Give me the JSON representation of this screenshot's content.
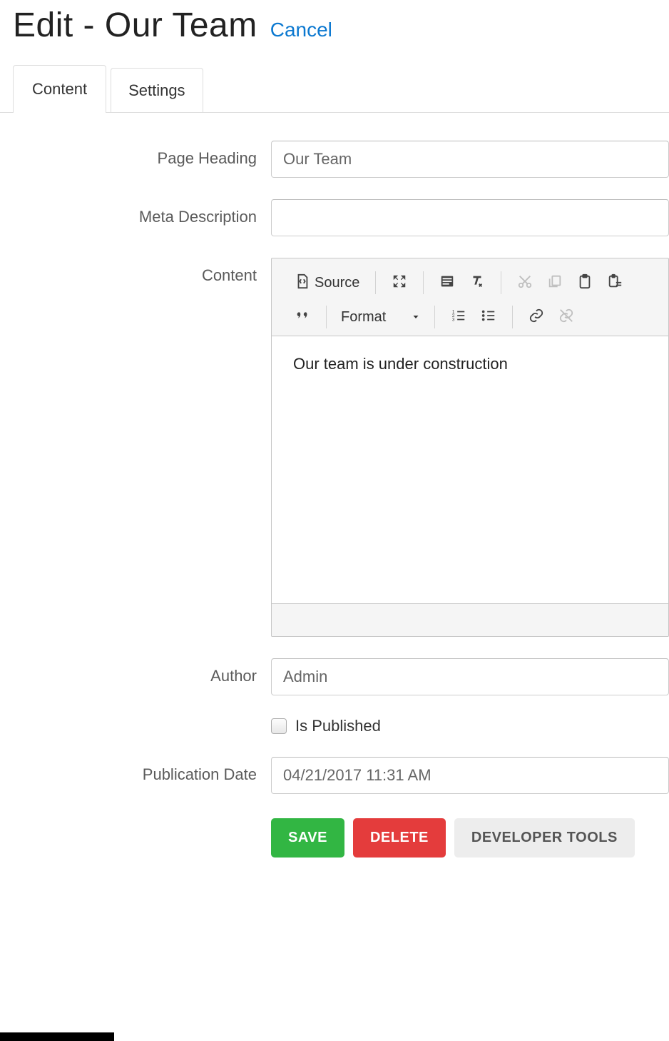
{
  "header": {
    "title": "Edit - Our Team",
    "cancel_label": "Cancel"
  },
  "tabs": {
    "content": "Content",
    "settings": "Settings"
  },
  "form": {
    "page_heading": {
      "label": "Page Heading",
      "value": "Our Team"
    },
    "meta_description": {
      "label": "Meta Description",
      "value": ""
    },
    "content": {
      "label": "Content",
      "body": "Our team is under construction"
    },
    "author": {
      "label": "Author",
      "value": "Admin"
    },
    "is_published": {
      "label": "Is Published",
      "checked": false
    },
    "publication_date": {
      "label": "Publication Date",
      "value": "04/21/2017 11:31 AM"
    }
  },
  "editor_toolbar": {
    "source": "Source",
    "format": "Format"
  },
  "buttons": {
    "save": "SAVE",
    "delete": "DELETE",
    "dev_tools": "DEVELOPER TOOLS"
  }
}
